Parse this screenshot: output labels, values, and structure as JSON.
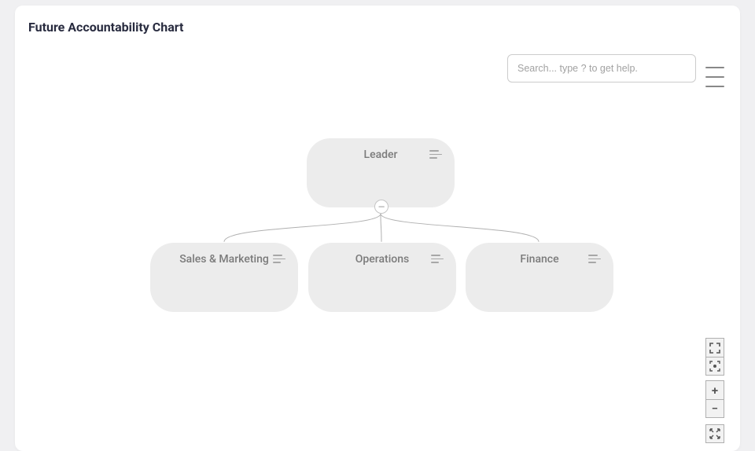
{
  "page": {
    "title": "Future Accountability Chart"
  },
  "search": {
    "placeholder": "Search... type ? to get help."
  },
  "chart": {
    "root": {
      "label": "Leader"
    },
    "children": [
      {
        "label": "Sales & Marketing"
      },
      {
        "label": "Operations"
      },
      {
        "label": "Finance"
      }
    ],
    "collapse_symbol": "—"
  },
  "zoom": {
    "plus": "+",
    "minus": "−"
  }
}
